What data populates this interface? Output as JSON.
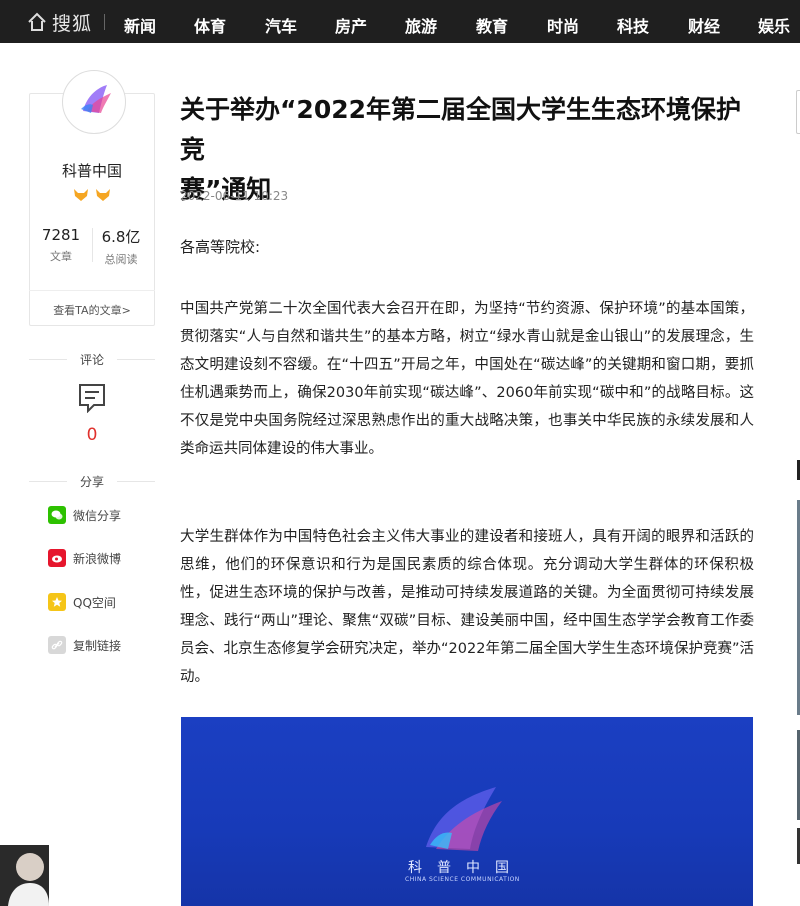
{
  "nav": {
    "brand": "搜狐",
    "items": [
      "新闻",
      "体育",
      "汽车",
      "房产",
      "旅游",
      "教育",
      "时尚",
      "科技",
      "财经",
      "娱乐"
    ]
  },
  "author": {
    "logo_text": "科普中国",
    "logo_sub": "CHINA SCIENCE COMMUNICATION",
    "name": "科普中国",
    "articles_count": "7281",
    "articles_label": "文章",
    "reads_count": "6.8亿",
    "reads_label": "总阅读",
    "view_link": "查看TA的文章>"
  },
  "sidebar": {
    "comment_label": "评论",
    "comment_count": "0",
    "share_label": "分享",
    "share_items": [
      {
        "label": "微信分享",
        "icon": "wechat-icon",
        "color": "#2dc100"
      },
      {
        "label": "新浪微博",
        "icon": "weibo-icon",
        "color": "#e6162d"
      },
      {
        "label": "QQ空间",
        "icon": "qzone-icon",
        "color": "#f5c518"
      },
      {
        "label": "复制链接",
        "icon": "link-icon",
        "color": "#cccccc"
      }
    ]
  },
  "article": {
    "title_line1": "关于举办“2022年第二届全国大学生生态环境保护竞",
    "title_line2": "赛”通知",
    "date": "2022-06-11 10:23",
    "greeting": "各高等院校:",
    "paragraph1": "中国共产党第二十次全国代表大会召开在即，为坚持“节约资源、保护环境”的基本国策，贯彻落实“人与自然和谐共生”的基本方略，树立“绿水青山就是金山银山”的发展理念，生态文明建设刻不容缓。在“十四五”开局之年，中国处在“碳达峰”的关键期和窗口期，要抓住机遇乘势而上，确保2030年前实现“碳达峰”、2060年前实现“碳中和”的战略目标。这不仅是党中央国务院经过深思熟虑作出的重大战略决策，也事关中华民族的永续发展和人类命运共同体建设的伟大事业。",
    "paragraph2": "大学生群体作为中国特色社会主义伟大事业的建设者和接班人，具有开阔的眼界和活跃的思维，他们的环保意识和行为是国民素质的综合体现。充分调动大学生群体的环保积极性，促进生态环境的保护与改善，是推动可持续发展道路的关键。为全面贯彻可持续发展理念、践行“两山”理论、聚焦“双碳”目标、建设美丽中国，经中国生态学学会教育工作委员会、北京生态修复学会研究决定，举办“2022年第二届全国大学生生态环境保护竞赛”活动。",
    "image_logo_text": "科普中国",
    "image_logo_sub": "CHINA SCIENCE COMMUNICATION"
  },
  "colors": {
    "nav_bg": "#1f1f1f",
    "accent_red": "#e0312d",
    "image_blue": "#1b3fc2"
  }
}
